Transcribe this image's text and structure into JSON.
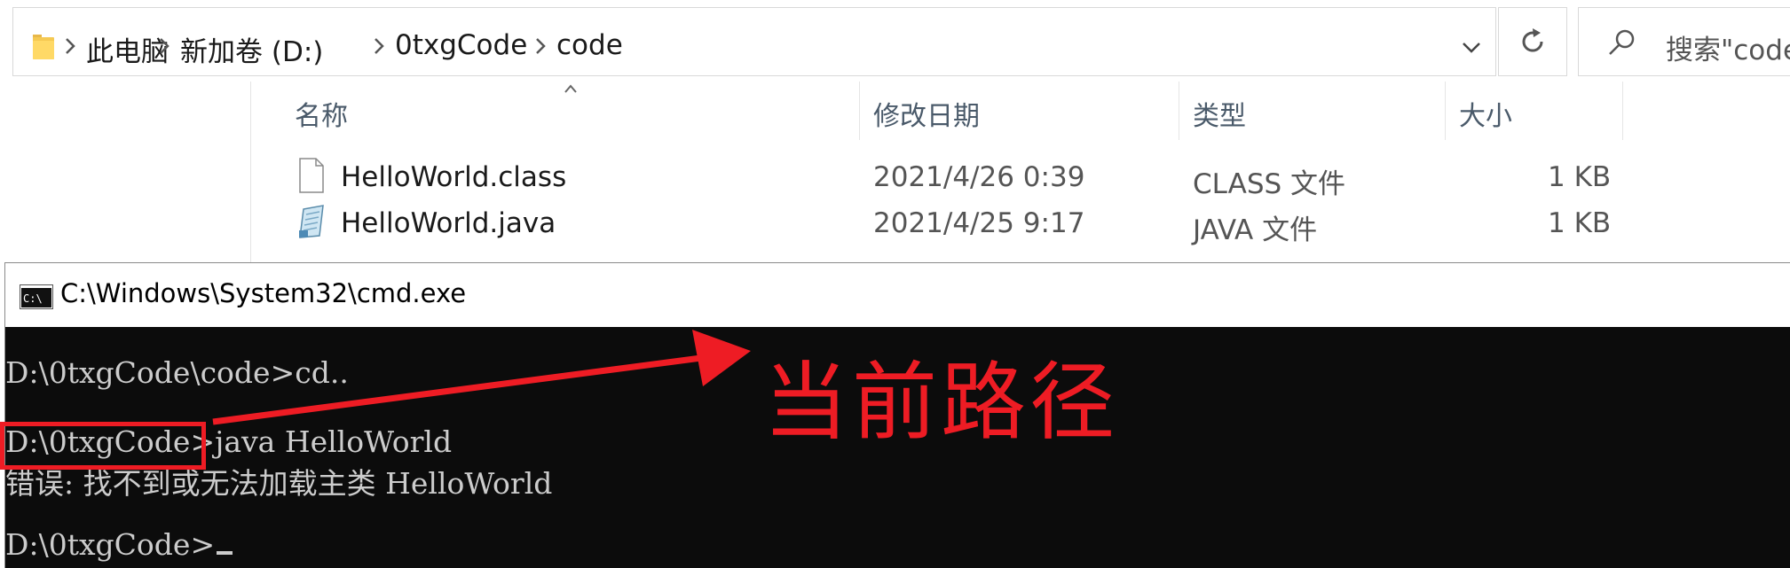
{
  "address_bar": {
    "breadcrumbs": [
      "此电脑",
      "新加卷 (D:)",
      "0txgCode",
      "code"
    ],
    "search_placeholder": "搜索\"code\""
  },
  "file_list": {
    "columns": [
      "名称",
      "修改日期",
      "类型",
      "大小"
    ],
    "rows": [
      {
        "name": "HelloWorld.class",
        "modified": "2021/4/26 0:39",
        "type": "CLASS 文件",
        "size": "1 KB",
        "icon": "blank-file-icon"
      },
      {
        "name": "HelloWorld.java",
        "modified": "2021/4/25 9:17",
        "type": "JAVA 文件",
        "size": "1 KB",
        "icon": "java-file-icon"
      }
    ]
  },
  "cmd": {
    "title": "C:\\Windows\\System32\\cmd.exe",
    "lines": [
      "D:\\0txgCode\\code>cd..",
      "",
      "D:\\0txgCode>java HelloWorld",
      "错误: 找不到或无法加载主类 HelloWorld",
      "",
      "D:\\0txgCode>"
    ]
  },
  "annotation": {
    "label": "当前路径",
    "color": "#ee1c24"
  },
  "colors": {
    "console_bg": "#0c0c0c",
    "console_text": "#cccccc",
    "accent_red": "#ee1c24"
  }
}
